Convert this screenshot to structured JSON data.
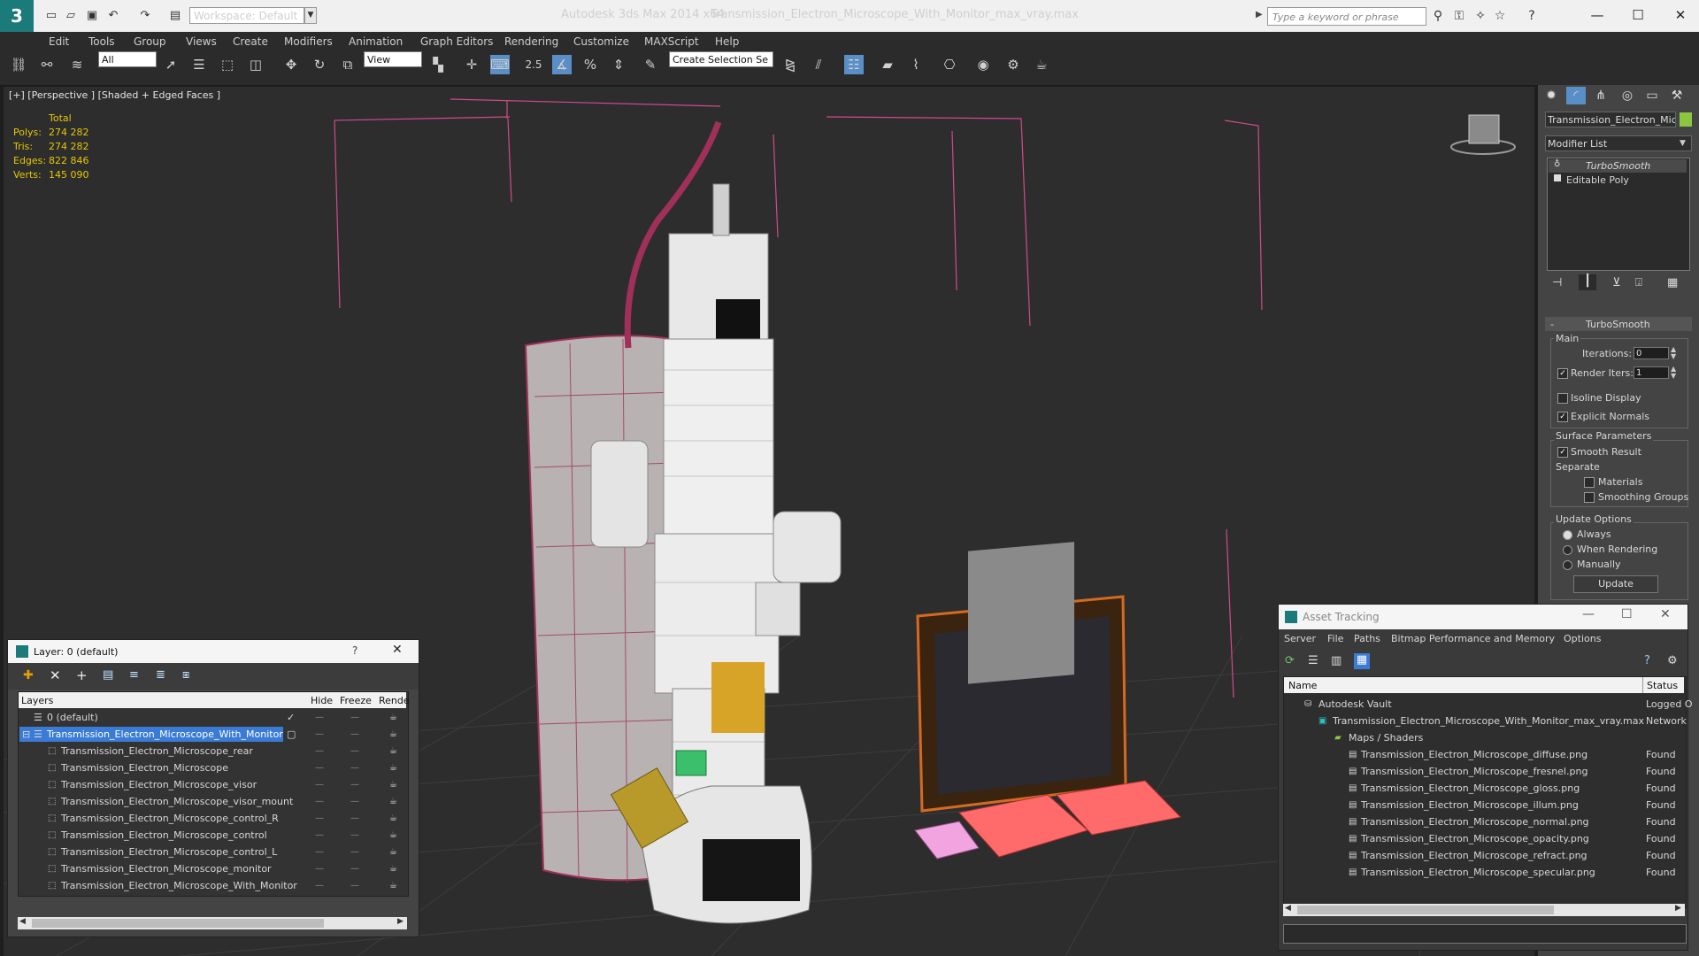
{
  "titlebar": {
    "workspace_label": "Workspace: Default",
    "app_title": "Autodesk 3ds Max  2014 x64",
    "file_title": "Transmission_Electron_Microscope_With_Monitor_max_vray.max",
    "search_placeholder": "Type a keyword or phrase"
  },
  "menu": [
    "Edit",
    "Tools",
    "Group",
    "Views",
    "Create",
    "Modifiers",
    "Animation",
    "Graph Editors",
    "Rendering",
    "Customize",
    "MAXScript",
    "Help"
  ],
  "toolbar": {
    "selection_filter": "All",
    "reference_coord": "View",
    "named_selection": "Create Selection Se"
  },
  "viewport": {
    "label": "[+] [Perspective ] [Shaded + Edged Faces ]",
    "stats_header": "Total",
    "stats": [
      {
        "label": "Polys:",
        "value": "274 282"
      },
      {
        "label": "Tris:",
        "value": "274 282"
      },
      {
        "label": "Edges:",
        "value": "822 846"
      },
      {
        "label": "Verts:",
        "value": "145 090"
      }
    ]
  },
  "command_panel": {
    "object_name": "Transmission_Electron_Micros",
    "modifier_list": "Modifier List",
    "stack": [
      "TurboSmooth",
      "Editable Poly"
    ],
    "rollout_title": "TurboSmooth",
    "main_group": "Main",
    "iterations_label": "Iterations:",
    "iterations_value": "0",
    "render_iters_label": "Render Iters:",
    "render_iters_value": "1",
    "isoline_label": "Isoline Display",
    "explicit_normals_label": "Explicit Normals",
    "surface_group": "Surface Parameters",
    "smooth_result_label": "Smooth Result",
    "separate_label": "Separate",
    "materials_label": "Materials",
    "smoothing_groups_label": "Smoothing Groups",
    "update_group": "Update Options",
    "always_label": "Always",
    "when_rendering_label": "When Rendering",
    "manually_label": "Manually",
    "update_button": "Update",
    "accent_color": "#8bc63e"
  },
  "layer_window": {
    "title": "Layer: 0 (default)",
    "help": "?",
    "columns": {
      "layers": "Layers",
      "hide": "Hide",
      "freeze": "Freeze",
      "render": "Rende"
    },
    "rows": [
      {
        "name": "0 (default)",
        "indent": 0
      },
      {
        "name": "Transmission_Electron_Microscope_With_Monitor",
        "indent": 0,
        "selected": true
      },
      {
        "name": "Transmission_Electron_Microscope_rear",
        "indent": 1
      },
      {
        "name": "Transmission_Electron_Microscope",
        "indent": 1
      },
      {
        "name": "Transmission_Electron_Microscope_visor",
        "indent": 1
      },
      {
        "name": "Transmission_Electron_Microscope_visor_mount",
        "indent": 1
      },
      {
        "name": "Transmission_Electron_Microscope_control_R",
        "indent": 1
      },
      {
        "name": "Transmission_Electron_Microscope_control",
        "indent": 1
      },
      {
        "name": "Transmission_Electron_Microscope_control_L",
        "indent": 1
      },
      {
        "name": "Transmission_Electron_Microscope_monitor",
        "indent": 1
      },
      {
        "name": "Transmission_Electron_Microscope_With_Monitor",
        "indent": 1
      }
    ],
    "dash": "—"
  },
  "asset_window": {
    "title": "Asset Tracking",
    "menu": [
      "Server",
      "File",
      "Paths",
      "Bitmap Performance and Memory",
      "Options"
    ],
    "columns": {
      "name": "Name",
      "status": "Status"
    },
    "rows": [
      {
        "name": "Autodesk Vault",
        "status": "Logged O"
      },
      {
        "name": "Transmission_Electron_Microscope_With_Monitor_max_vray.max",
        "status": "Network"
      },
      {
        "name": "Maps / Shaders",
        "status": ""
      },
      {
        "name": "Transmission_Electron_Microscope_diffuse.png",
        "status": "Found"
      },
      {
        "name": "Transmission_Electron_Microscope_fresnel.png",
        "status": "Found"
      },
      {
        "name": "Transmission_Electron_Microscope_gloss.png",
        "status": "Found"
      },
      {
        "name": "Transmission_Electron_Microscope_illum.png",
        "status": "Found"
      },
      {
        "name": "Transmission_Electron_Microscope_normal.png",
        "status": "Found"
      },
      {
        "name": "Transmission_Electron_Microscope_opacity.png",
        "status": "Found"
      },
      {
        "name": "Transmission_Electron_Microscope_refract.png",
        "status": "Found"
      },
      {
        "name": "Transmission_Electron_Microscope_specular.png",
        "status": "Found"
      }
    ]
  }
}
